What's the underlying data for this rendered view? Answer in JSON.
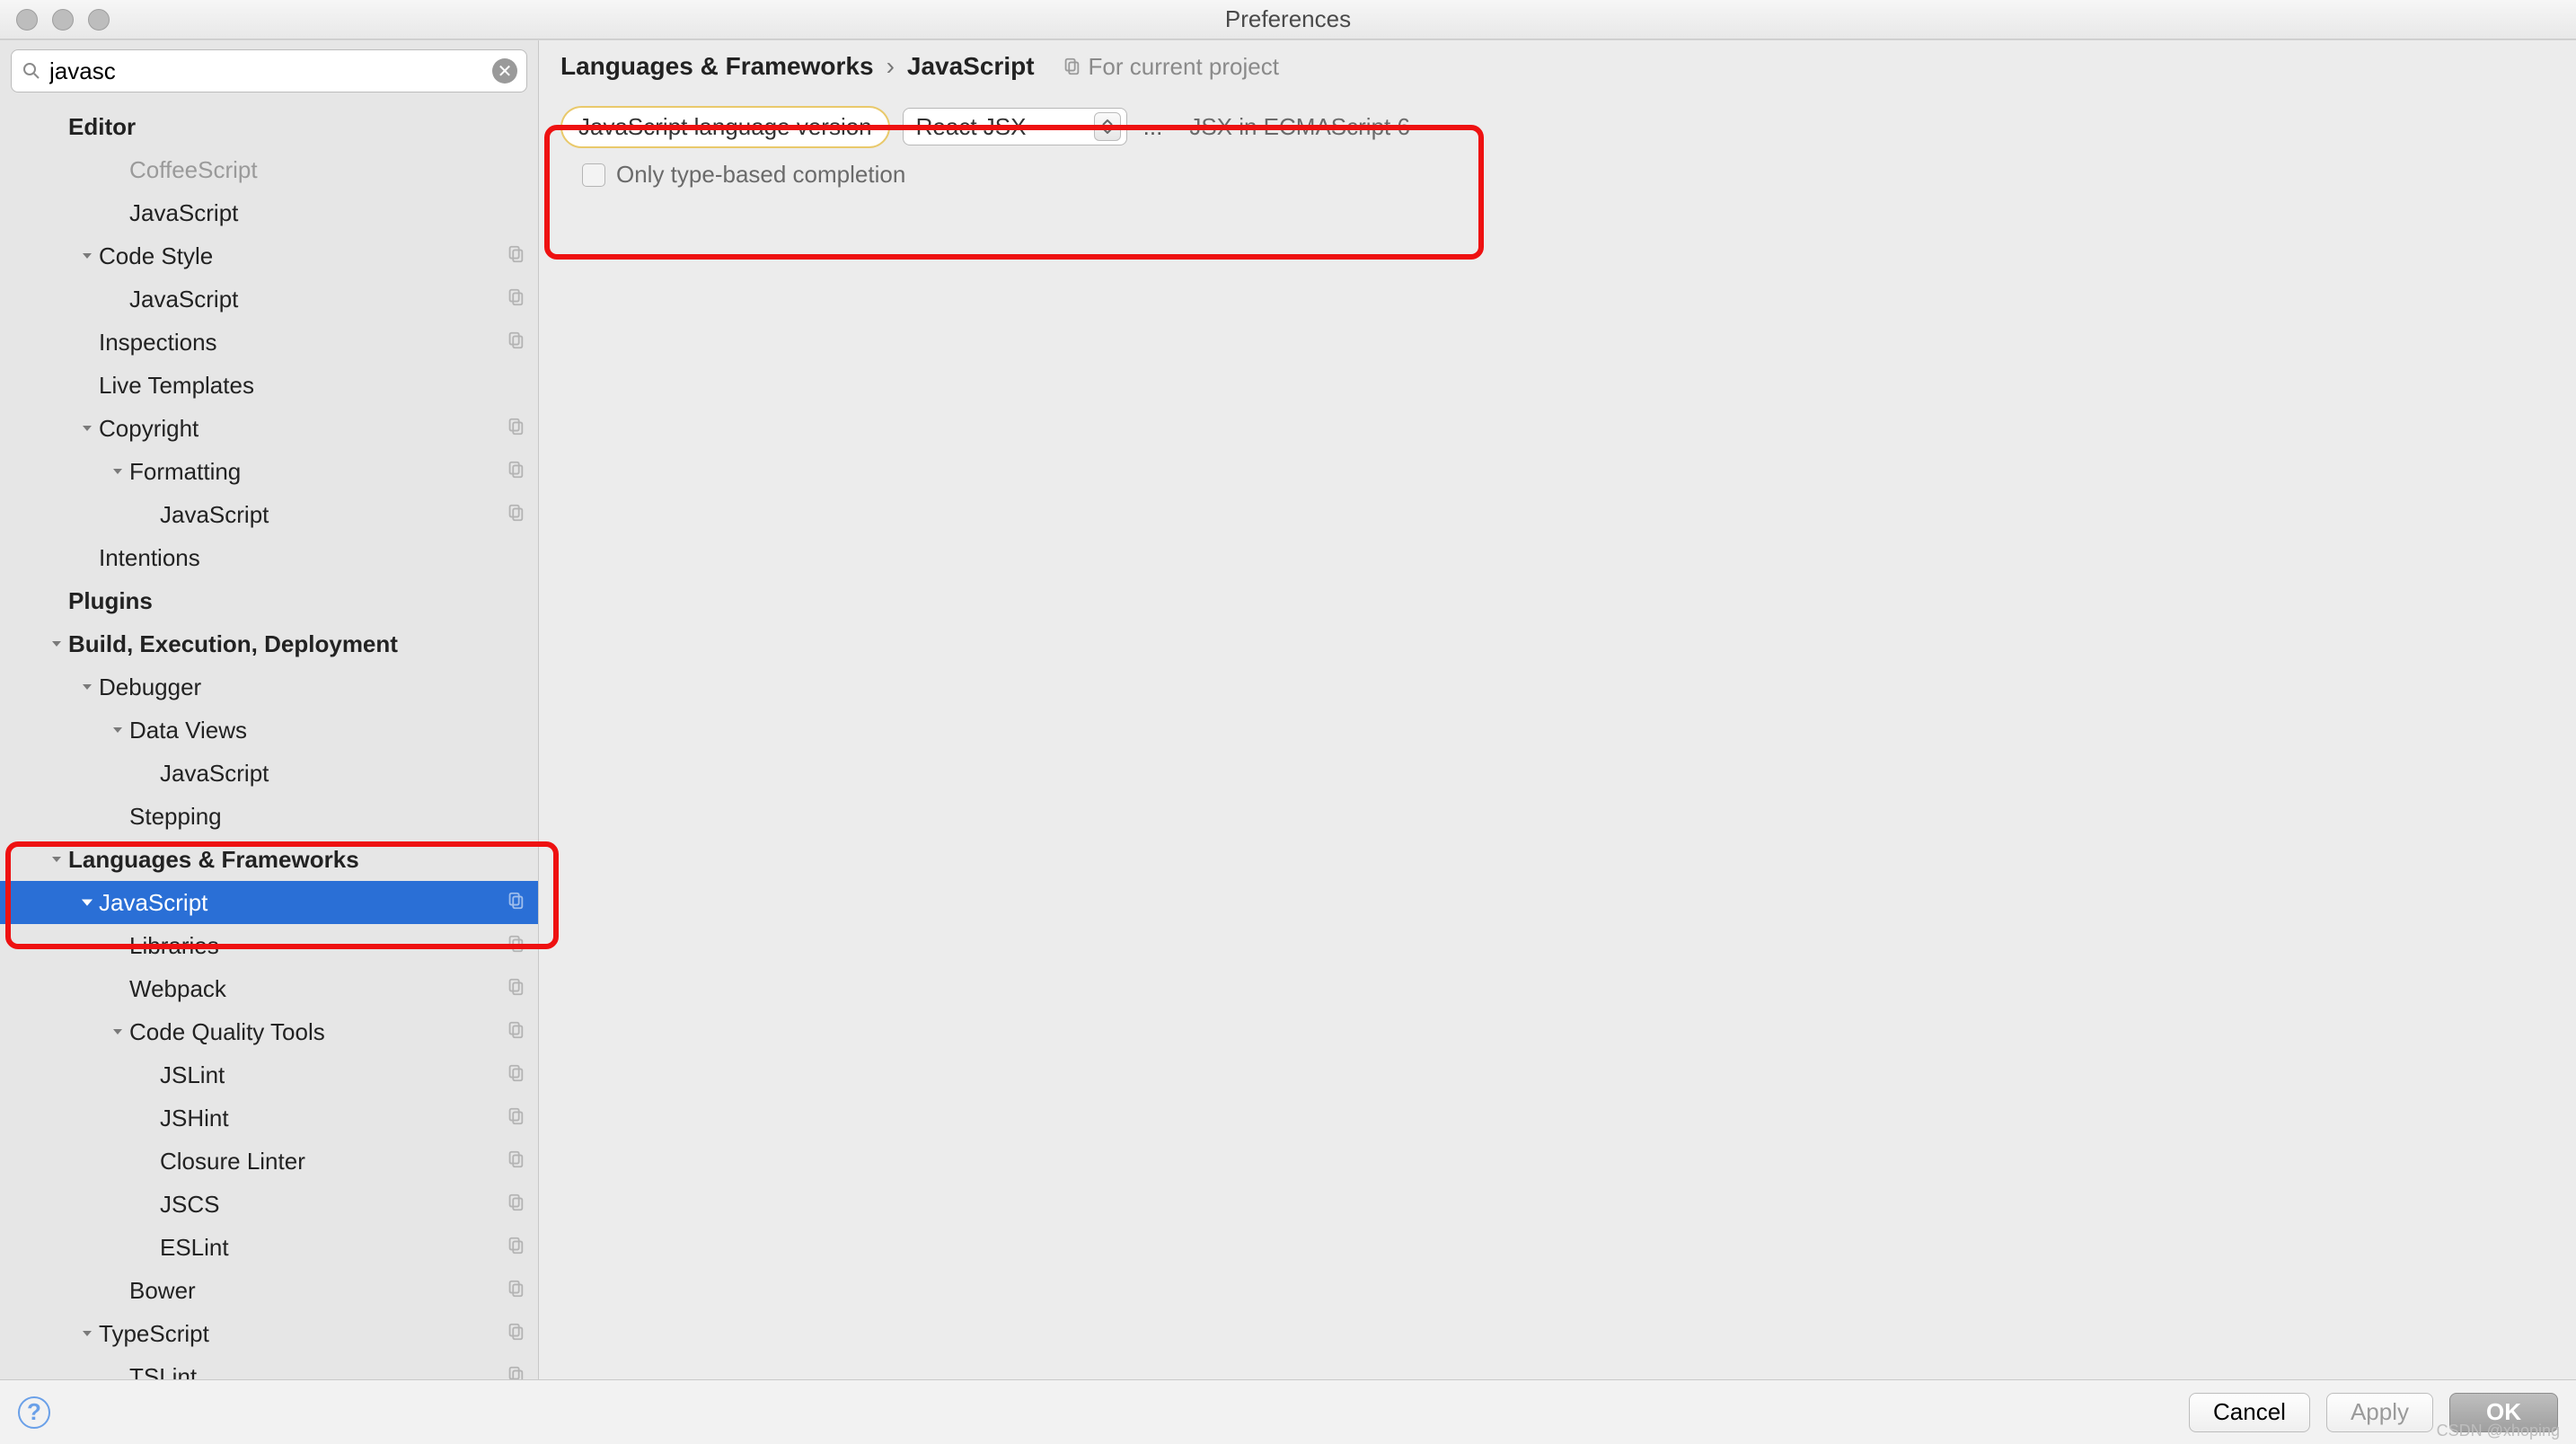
{
  "window": {
    "title": "Preferences"
  },
  "search": {
    "value": "javasc"
  },
  "breadcrumb": {
    "crumb1": "Languages & Frameworks",
    "sep": "›",
    "crumb2": "JavaScript",
    "scope": "For current project"
  },
  "form": {
    "label": "JavaScript language version",
    "select_value": "React JSX",
    "dots": "...",
    "hint": "JSX in ECMAScript 6",
    "checkbox_label": "Only type-based completion"
  },
  "footer": {
    "cancel": "Cancel",
    "apply": "Apply",
    "ok": "OK"
  },
  "watermark": "CSDN @xhoping",
  "tree": [
    {
      "label": "Editor",
      "bold": true,
      "indent": 1,
      "arrow": ""
    },
    {
      "label": "CoffeeScript",
      "indent": 3,
      "dim": true
    },
    {
      "label": "JavaScript",
      "indent": 3
    },
    {
      "label": "Code Style",
      "indent": 2,
      "arrow": "down",
      "copy": true
    },
    {
      "label": "JavaScript",
      "indent": 3,
      "copy": true
    },
    {
      "label": "Inspections",
      "indent": 2,
      "copy": true
    },
    {
      "label": "Live Templates",
      "indent": 2
    },
    {
      "label": "Copyright",
      "indent": 2,
      "arrow": "down",
      "copy": true
    },
    {
      "label": "Formatting",
      "indent": 3,
      "arrow": "down",
      "copy": true
    },
    {
      "label": "JavaScript",
      "indent": 4,
      "copy": true
    },
    {
      "label": "Intentions",
      "indent": 2
    },
    {
      "label": "Plugins",
      "bold": true,
      "indent": 1
    },
    {
      "label": "Build, Execution, Deployment",
      "bold": true,
      "indent": 1,
      "arrow": "down"
    },
    {
      "label": "Debugger",
      "indent": 2,
      "arrow": "down"
    },
    {
      "label": "Data Views",
      "indent": 3,
      "arrow": "down"
    },
    {
      "label": "JavaScript",
      "indent": 4
    },
    {
      "label": "Stepping",
      "indent": 3
    },
    {
      "label": "Languages & Frameworks",
      "bold": true,
      "indent": 1,
      "arrow": "down"
    },
    {
      "label": "JavaScript",
      "indent": 2,
      "arrow": "down",
      "selected": true,
      "copy": true
    },
    {
      "label": "Libraries",
      "indent": 3,
      "copy": true
    },
    {
      "label": "Webpack",
      "indent": 3,
      "copy": true
    },
    {
      "label": "Code Quality Tools",
      "indent": 3,
      "arrow": "down",
      "copy": true
    },
    {
      "label": "JSLint",
      "indent": 4,
      "copy": true
    },
    {
      "label": "JSHint",
      "indent": 4,
      "copy": true
    },
    {
      "label": "Closure Linter",
      "indent": 4,
      "copy": true
    },
    {
      "label": "JSCS",
      "indent": 4,
      "copy": true
    },
    {
      "label": "ESLint",
      "indent": 4,
      "copy": true
    },
    {
      "label": "Bower",
      "indent": 3,
      "copy": true
    },
    {
      "label": "TypeScript",
      "indent": 2,
      "arrow": "down",
      "copy": true
    },
    {
      "label": "TSLint",
      "indent": 3,
      "copy": true
    }
  ]
}
